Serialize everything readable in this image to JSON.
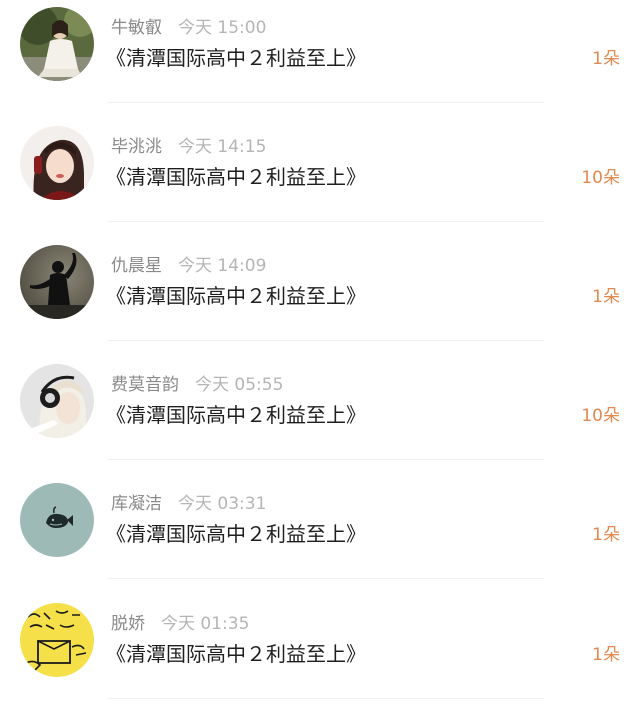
{
  "items": [
    {
      "name": "牛敏叡",
      "time": "今天 15:00",
      "title": "《清潭国际高中２利益至上》",
      "amount": "1朵",
      "avatar_icon": "avatar-woman-outdoor"
    },
    {
      "name": "毕洮洮",
      "time": "今天 14:15",
      "title": "《清潭国际高中２利益至上》",
      "amount": "10朵",
      "avatar_icon": "avatar-woman-selfie"
    },
    {
      "name": "仇晨星",
      "time": "今天 14:09",
      "title": "《清潭国际高中２利益至上》",
      "amount": "1朵",
      "avatar_icon": "avatar-silhouette-dancer"
    },
    {
      "name": "费莫音韵",
      "time": "今天 05:55",
      "title": "《清潭国际高中２利益至上》",
      "amount": "10朵",
      "avatar_icon": "avatar-headphones-girl"
    },
    {
      "name": "库凝洁",
      "time": "今天 03:31",
      "title": "《清潭国际高中２利益至上》",
      "amount": "1朵",
      "avatar_icon": "avatar-whale-teal"
    },
    {
      "name": "脱娇",
      "time": "今天 01:35",
      "title": "《清潭国际高中２利益至上》",
      "amount": "1朵",
      "avatar_icon": "avatar-yellow-doodle"
    }
  ],
  "colors": {
    "amount": "#e08a4f",
    "name": "#8a8a8a",
    "time": "#b5b5b5",
    "title": "#1f1f1f",
    "divider": "#f0f0f0"
  }
}
